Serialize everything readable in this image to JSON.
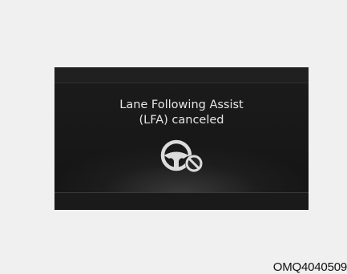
{
  "display": {
    "message_line1": "Lane Following Assist",
    "message_line2": "(LFA) canceled",
    "icon": "steering-wheel-canceled-icon"
  },
  "figure_code": "OMQ4040509",
  "colors": {
    "page_background": "#f0f0f0",
    "display_background": "#191919",
    "display_text": "#e6e6e6",
    "icon_color": "#dcdcdc"
  }
}
